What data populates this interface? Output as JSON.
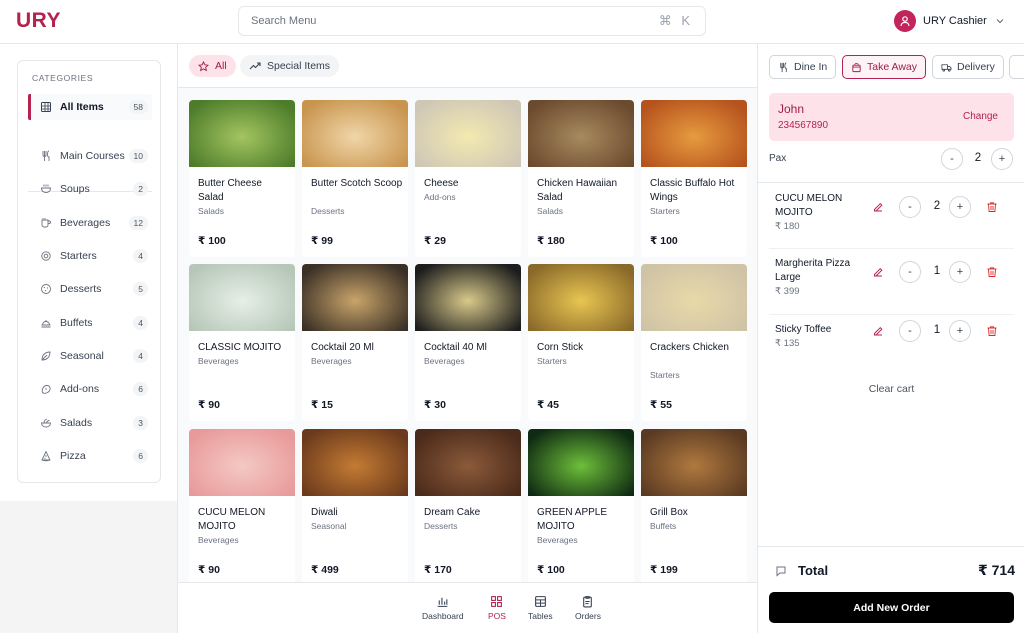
{
  "app": {
    "logo": "URY"
  },
  "header": {
    "search_placeholder": "Search Menu",
    "search_shortcut": "⌘ K",
    "user_name": "URY Cashier"
  },
  "sidebar": {
    "title": "CATEGORIES",
    "items": [
      {
        "label": "All Items",
        "count": "58",
        "icon": "grid-icon",
        "active": true
      },
      {
        "label": "Main Courses",
        "count": "10",
        "icon": "utensils-icon"
      },
      {
        "label": "Soups",
        "count": "2",
        "icon": "soup-icon"
      },
      {
        "label": "Beverages",
        "count": "12",
        "icon": "cup-icon"
      },
      {
        "label": "Starters",
        "count": "4",
        "icon": "starter-icon"
      },
      {
        "label": "Desserts",
        "count": "5",
        "icon": "cookie-icon"
      },
      {
        "label": "Buffets",
        "count": "4",
        "icon": "buffet-icon"
      },
      {
        "label": "Seasonal",
        "count": "4",
        "icon": "leaf-icon"
      },
      {
        "label": "Add-ons",
        "count": "6",
        "icon": "addon-icon"
      },
      {
        "label": "Salads",
        "count": "3",
        "icon": "salad-icon"
      },
      {
        "label": "Pizza",
        "count": "6",
        "icon": "pizza-icon"
      }
    ]
  },
  "filters": {
    "all_label": "All",
    "special_label": "Special Items"
  },
  "menu_items": [
    {
      "name": "Butter Cheese Salad",
      "category": "Salads",
      "price": "₹ 100",
      "colors": [
        "#4d7c2a",
        "#a3c560"
      ]
    },
    {
      "name": "Butter Scotch Scoop",
      "category": "Desserts",
      "price": "₹ 99",
      "colors": [
        "#c8944e",
        "#f0d6a8"
      ]
    },
    {
      "name": "Cheese",
      "category": "Add-ons",
      "price": "₹ 29",
      "colors": [
        "#cfc7b6",
        "#f3e9b0"
      ]
    },
    {
      "name": "Chicken Hawaiian Salad",
      "category": "Salads",
      "price": "₹ 180",
      "colors": [
        "#6b4a2e",
        "#a88a5e"
      ]
    },
    {
      "name": "Classic Buffalo Hot Wings",
      "category": "Starters",
      "price": "₹ 100",
      "colors": [
        "#b5521d",
        "#e79b3f"
      ]
    },
    {
      "name": "CLASSIC MOJITO",
      "category": "Beverages",
      "price": "₹ 90",
      "colors": [
        "#b6c7b8",
        "#e7efe6"
      ]
    },
    {
      "name": "Cocktail 20 Ml",
      "category": "Beverages",
      "price": "₹ 15",
      "colors": [
        "#3a3026",
        "#c9a46a"
      ]
    },
    {
      "name": "Cocktail 40 Ml",
      "category": "Beverages",
      "price": "₹ 30",
      "colors": [
        "#1d1d1d",
        "#d8c98a"
      ]
    },
    {
      "name": "Corn Stick",
      "category": "Starters",
      "price": "₹ 45",
      "colors": [
        "#8a6a2a",
        "#e9c552"
      ]
    },
    {
      "name": "Crackers Chicken",
      "category": "Starters",
      "price": "₹ 55",
      "colors": [
        "#cfc3a6",
        "#e9d9a8"
      ]
    },
    {
      "name": "CUCU MELON MOJITO",
      "category": "Beverages",
      "price": "₹ 90",
      "colors": [
        "#e89a9a",
        "#f4c9c3"
      ]
    },
    {
      "name": "Diwali",
      "category": "Seasonal",
      "price": "₹ 499",
      "colors": [
        "#6b3a1c",
        "#c47b33"
      ]
    },
    {
      "name": "Dream Cake",
      "category": "Desserts",
      "price": "₹ 170",
      "colors": [
        "#4a2a1a",
        "#8b5a3a"
      ]
    },
    {
      "name": "GREEN APPLE MOJITO",
      "category": "Beverages",
      "price": "₹ 100",
      "colors": [
        "#0f2a12",
        "#6dbf3a"
      ]
    },
    {
      "name": "Grill Box",
      "category": "Buffets",
      "price": "₹ 199",
      "colors": [
        "#5a3a22",
        "#b0793f"
      ]
    }
  ],
  "order": {
    "tabs": [
      {
        "label": "Dine In",
        "icon": "utensils-icon"
      },
      {
        "label": "Take Away",
        "icon": "bag-icon",
        "active": true
      },
      {
        "label": "Delivery",
        "icon": "truck-icon"
      }
    ],
    "customer_name": "John",
    "customer_phone": "234567890",
    "change_label": "Change",
    "pax_label": "Pax",
    "pax_value": "2",
    "items": [
      {
        "name": "CUCU MELON MOJITO",
        "price": "₹ 180",
        "qty": "2"
      },
      {
        "name": "Margherita Pizza Large",
        "price": "₹ 399",
        "qty": "1"
      },
      {
        "name": "Sticky Toffee",
        "price": "₹ 135",
        "qty": "1"
      }
    ],
    "clear_label": "Clear cart",
    "total_label": "Total",
    "total_value": "₹ 714",
    "add_order_label": "Add New Order"
  },
  "bottom_nav": [
    {
      "label": "Dashboard",
      "icon": "chart-icon"
    },
    {
      "label": "POS",
      "icon": "pos-grid-icon",
      "active": true
    },
    {
      "label": "Tables",
      "icon": "table-icon"
    },
    {
      "label": "Orders",
      "icon": "clipboard-icon"
    }
  ],
  "colors": {
    "accent": "#b4234f",
    "accent_light": "#fde2ea"
  }
}
